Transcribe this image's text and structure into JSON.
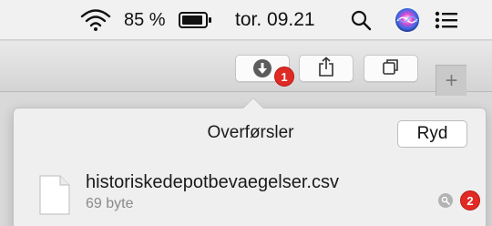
{
  "menubar": {
    "battery_percent": "85 %",
    "clock": "tor. 09.21",
    "icons": [
      "wifi-icon",
      "battery-icon",
      "search-icon",
      "siri-icon",
      "notification-list-icon"
    ]
  },
  "toolbar": {
    "downloads_badge": "1",
    "buttons": [
      "downloads-button",
      "share-button",
      "tabs-overview-button"
    ],
    "new_tab_symbol": "+"
  },
  "downloads_popover": {
    "title": "Overførsler",
    "clear_label": "Ryd",
    "items": [
      {
        "filename": "historiskedepotbevaegelser.csv",
        "size": "69 byte",
        "badge": "2"
      }
    ]
  },
  "colors": {
    "badge_red": "#e02a23",
    "menubar_bg": "#f1f1f1",
    "popover_bg": "#efefef"
  }
}
